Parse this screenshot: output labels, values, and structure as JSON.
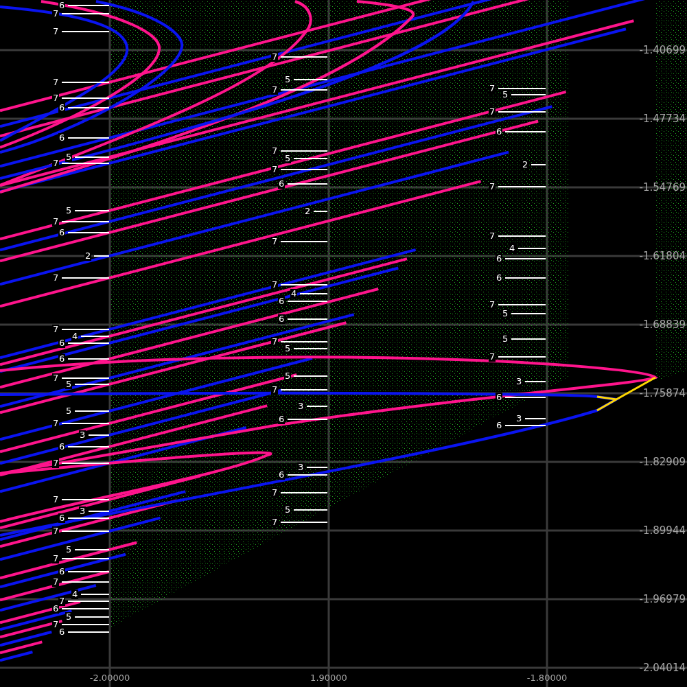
{
  "plot": {
    "x_ticks": [
      "-2.00000",
      "1.90000",
      "-1.80000"
    ],
    "y_ticks": [
      "-1.40699",
      "-1.47734",
      "-1.54769",
      "-1.61804",
      "-1.68839",
      "-1.75874",
      "-1.82909",
      "-1.89944",
      "-1.96979",
      "-2.04014"
    ],
    "period_labels": {
      "column_1": [
        "6",
        "7",
        "7",
        "7",
        "7",
        "6",
        "6",
        "5",
        "7",
        "5",
        "7",
        "6",
        "2",
        "7",
        "7",
        "4",
        "6",
        "6",
        "7",
        "5",
        "5",
        "7",
        "3",
        "6",
        "7",
        "7",
        "3",
        "6",
        "7",
        "5",
        "7",
        "6",
        "7",
        "4",
        "7",
        "6",
        "5",
        "7",
        "6"
      ],
      "column_2": [
        "7",
        "5",
        "7",
        "7",
        "5",
        "7",
        "6",
        "2",
        "7",
        "7",
        "4",
        "6",
        "6",
        "7",
        "5",
        "5",
        "7",
        "3",
        "6",
        "3",
        "6",
        "7",
        "5",
        "7"
      ],
      "column_3": [
        "7",
        "5",
        "7",
        "6",
        "2",
        "7",
        "7",
        "4",
        "6",
        "6",
        "7",
        "5",
        "5",
        "7",
        "3",
        "6",
        "3",
        "6"
      ]
    }
  }
}
